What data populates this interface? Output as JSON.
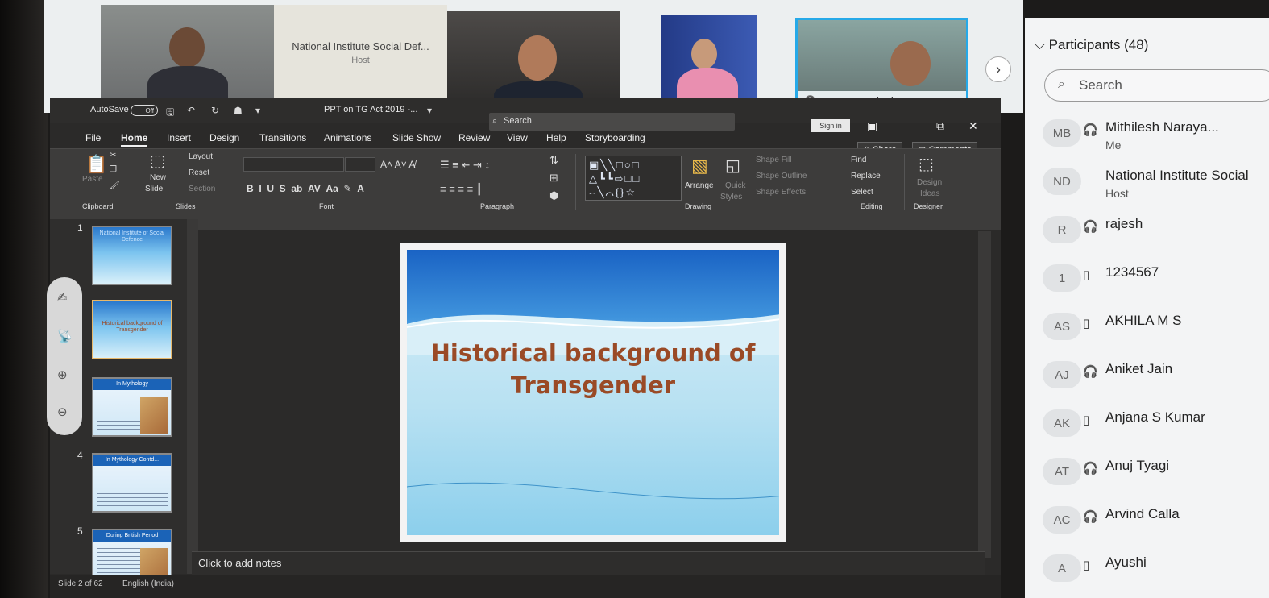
{
  "meeting": {
    "host_tile": {
      "name": "National Institute Social Def...",
      "role": "Host"
    },
    "active_speaker_label": "rajesh",
    "next_icon": "chevron-right-icon"
  },
  "ppt": {
    "autosave_label": "AutoSave",
    "autosave_state": "Off",
    "doc_title": "PPT on TG Act 2019 -...",
    "search_placeholder": "Search",
    "signin_label": "Sign in",
    "tabs": [
      "File",
      "Home",
      "Insert",
      "Design",
      "Transitions",
      "Animations",
      "Slide Show",
      "Review",
      "View",
      "Help",
      "Storyboarding"
    ],
    "share_label": "Share",
    "comments_label": "Comments",
    "ribbon": {
      "paste": "Paste",
      "new_slide": "New",
      "new_slide_2": "Slide",
      "layout": "Layout",
      "reset": "Reset",
      "section": "Section",
      "clipboard": "Clipboard",
      "slides": "Slides",
      "font": "Font",
      "paragraph": "Paragraph",
      "drawing": "Drawing",
      "arrange": "Arrange",
      "quick_styles": "Quick",
      "quick_styles_2": "Styles",
      "shape_fill": "Shape Fill",
      "shape_outline": "Shape Outline",
      "shape_effects": "Shape Effects",
      "find": "Find",
      "replace": "Replace",
      "select": "Select",
      "editing": "Editing",
      "design_ideas": "Design",
      "design_ideas_2": "Ideas",
      "designer": "Designer"
    },
    "thumbnails": [
      {
        "num": "1",
        "title": "National Institute of Social Defence"
      },
      {
        "num": "",
        "title": "Historical background of Transgender"
      },
      {
        "num": "",
        "title": "In Mythology"
      },
      {
        "num": "4",
        "title": "In Mythology Contd..."
      },
      {
        "num": "5",
        "title": "During British Period"
      }
    ],
    "slide": {
      "title_line1": "Historical background of",
      "title_line2": "Transgender"
    },
    "notes_placeholder": "Click to add notes",
    "status": {
      "slide_counter": "Slide 2 of 62",
      "language": "English (India)"
    }
  },
  "participants": {
    "header": "Participants (48)",
    "search_placeholder": "Search",
    "list": [
      {
        "initials": "MB",
        "device": "headset-icon",
        "name": "Mithilesh Naraya...",
        "sub": "Me"
      },
      {
        "initials": "ND",
        "device": "",
        "name": "National Institute Social",
        "sub": "Host"
      },
      {
        "initials": "R",
        "device": "headset-icon",
        "name": "rajesh",
        "sub": ""
      },
      {
        "initials": "1",
        "device": "phone-icon",
        "name": "1234567",
        "sub": ""
      },
      {
        "initials": "AS",
        "device": "phone-icon",
        "name": "AKHILA M S",
        "sub": ""
      },
      {
        "initials": "AJ",
        "device": "headset-icon",
        "name": "Aniket Jain",
        "sub": ""
      },
      {
        "initials": "AK",
        "device": "phone-icon",
        "name": "Anjana S Kumar",
        "sub": ""
      },
      {
        "initials": "AT",
        "device": "headset-icon",
        "name": "Anuj Tyagi",
        "sub": ""
      },
      {
        "initials": "AC",
        "device": "headset-icon",
        "name": "Arvind Calla",
        "sub": ""
      },
      {
        "initials": "A",
        "device": "phone-icon",
        "name": "Ayushi",
        "sub": ""
      }
    ]
  }
}
